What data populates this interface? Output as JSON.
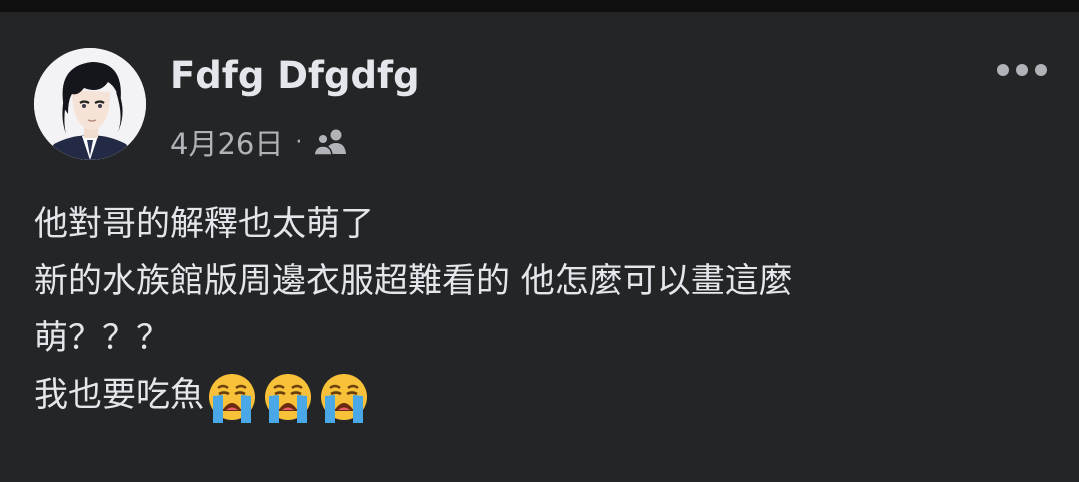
{
  "post": {
    "author": "Fdfg Dfgdfg",
    "date": "4月26日",
    "separator": "·",
    "audience_icon": "friends-icon",
    "more_icon": "more-horizontal-icon",
    "lines": [
      "他對哥的解釋也太萌了",
      "新的水族館版周邊衣服超難看的 他怎麼可以畫這麼",
      "萌？？？",
      "我也要吃魚"
    ],
    "emojis": [
      "loudly-crying-face-icon",
      "loudly-crying-face-icon",
      "loudly-crying-face-icon"
    ]
  },
  "colors": {
    "background": "#242526",
    "primary_text": "#e4e6eb",
    "secondary_text": "#b0b3b8"
  }
}
